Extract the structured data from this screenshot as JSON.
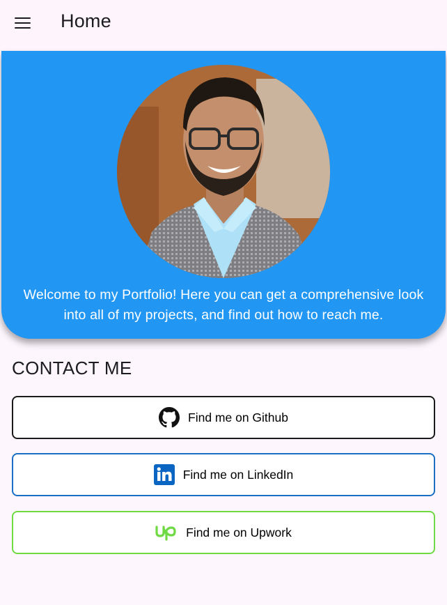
{
  "appbar": {
    "title": "Home",
    "menu_icon": "hamburger-menu-icon"
  },
  "hero": {
    "background_color": "#2196f3",
    "avatar_alt": "profile photo",
    "welcome_text": "Welcome to my Portfolio! Here you can get a comprehensive look into all of my projects, and find out how to reach me."
  },
  "contact": {
    "section_title": "CONTACT ME",
    "buttons": [
      {
        "label": "Find me on Github",
        "icon": "github-icon",
        "border_color": "#1a1a1a"
      },
      {
        "label": "Find me on LinkedIn",
        "icon": "linkedin-icon",
        "border_color": "#1a6fc4"
      },
      {
        "label": "Find me on Upwork",
        "icon": "upwork-icon",
        "border_color": "#6fda44"
      }
    ]
  }
}
